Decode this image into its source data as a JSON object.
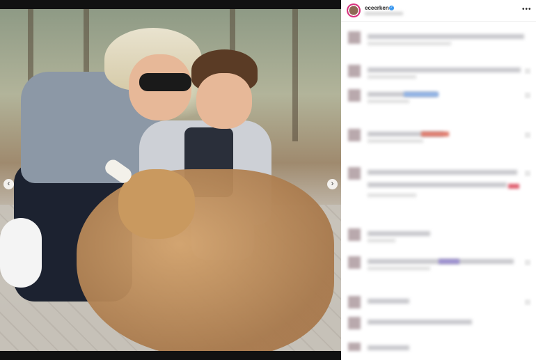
{
  "post": {
    "username": "eceerken",
    "verified": true,
    "more_icon": "more-horizontal-icon",
    "carousel": {
      "prev_icon": "chevron-left-icon",
      "next_icon": "chevron-right-icon"
    }
  },
  "comments_area": {
    "state": "blurred"
  },
  "colors": {
    "verified_badge": "#3897f0",
    "story_ring": "#d9337f"
  }
}
